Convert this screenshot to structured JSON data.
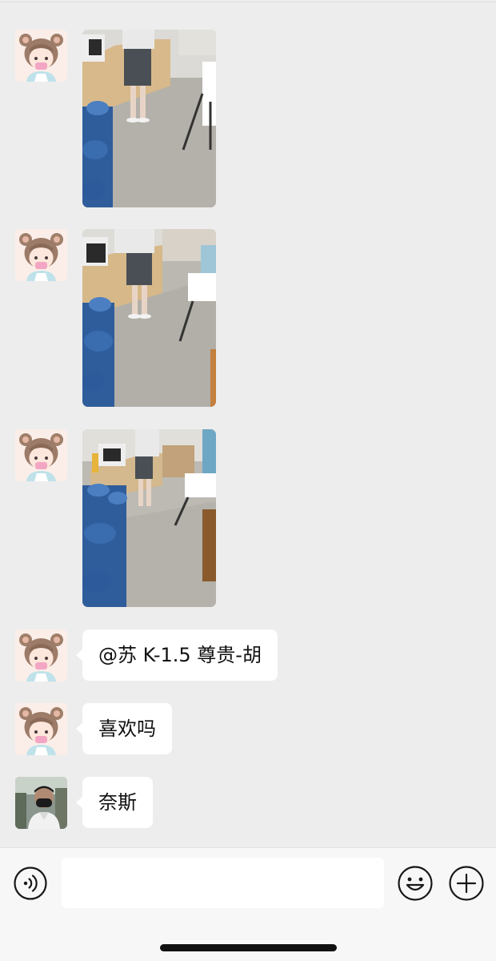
{
  "chat": {
    "messages": [
      {
        "type": "image",
        "sender": "bear-hood-girl-avatar",
        "image": "photo-office-water-jugs-1"
      },
      {
        "type": "image",
        "sender": "bear-hood-girl-avatar",
        "image": "photo-office-water-jugs-2"
      },
      {
        "type": "image",
        "sender": "bear-hood-girl-avatar",
        "image": "photo-office-water-jugs-3"
      },
      {
        "type": "text",
        "sender": "bear-hood-girl-avatar",
        "text": "@苏 K-1.5 尊贵-胡"
      },
      {
        "type": "text",
        "sender": "bear-hood-girl-avatar",
        "text": "喜欢吗"
      },
      {
        "type": "text",
        "sender": "masked-man-avatar",
        "text": "奈斯"
      }
    ]
  },
  "input_bar": {
    "voice_icon": "voice-icon",
    "emoji_icon": "emoji-icon",
    "plus_icon": "plus-icon",
    "text_value": ""
  },
  "colors": {
    "background": "#ededed",
    "bubble": "#ffffff",
    "input_bar": "#f7f7f7"
  }
}
